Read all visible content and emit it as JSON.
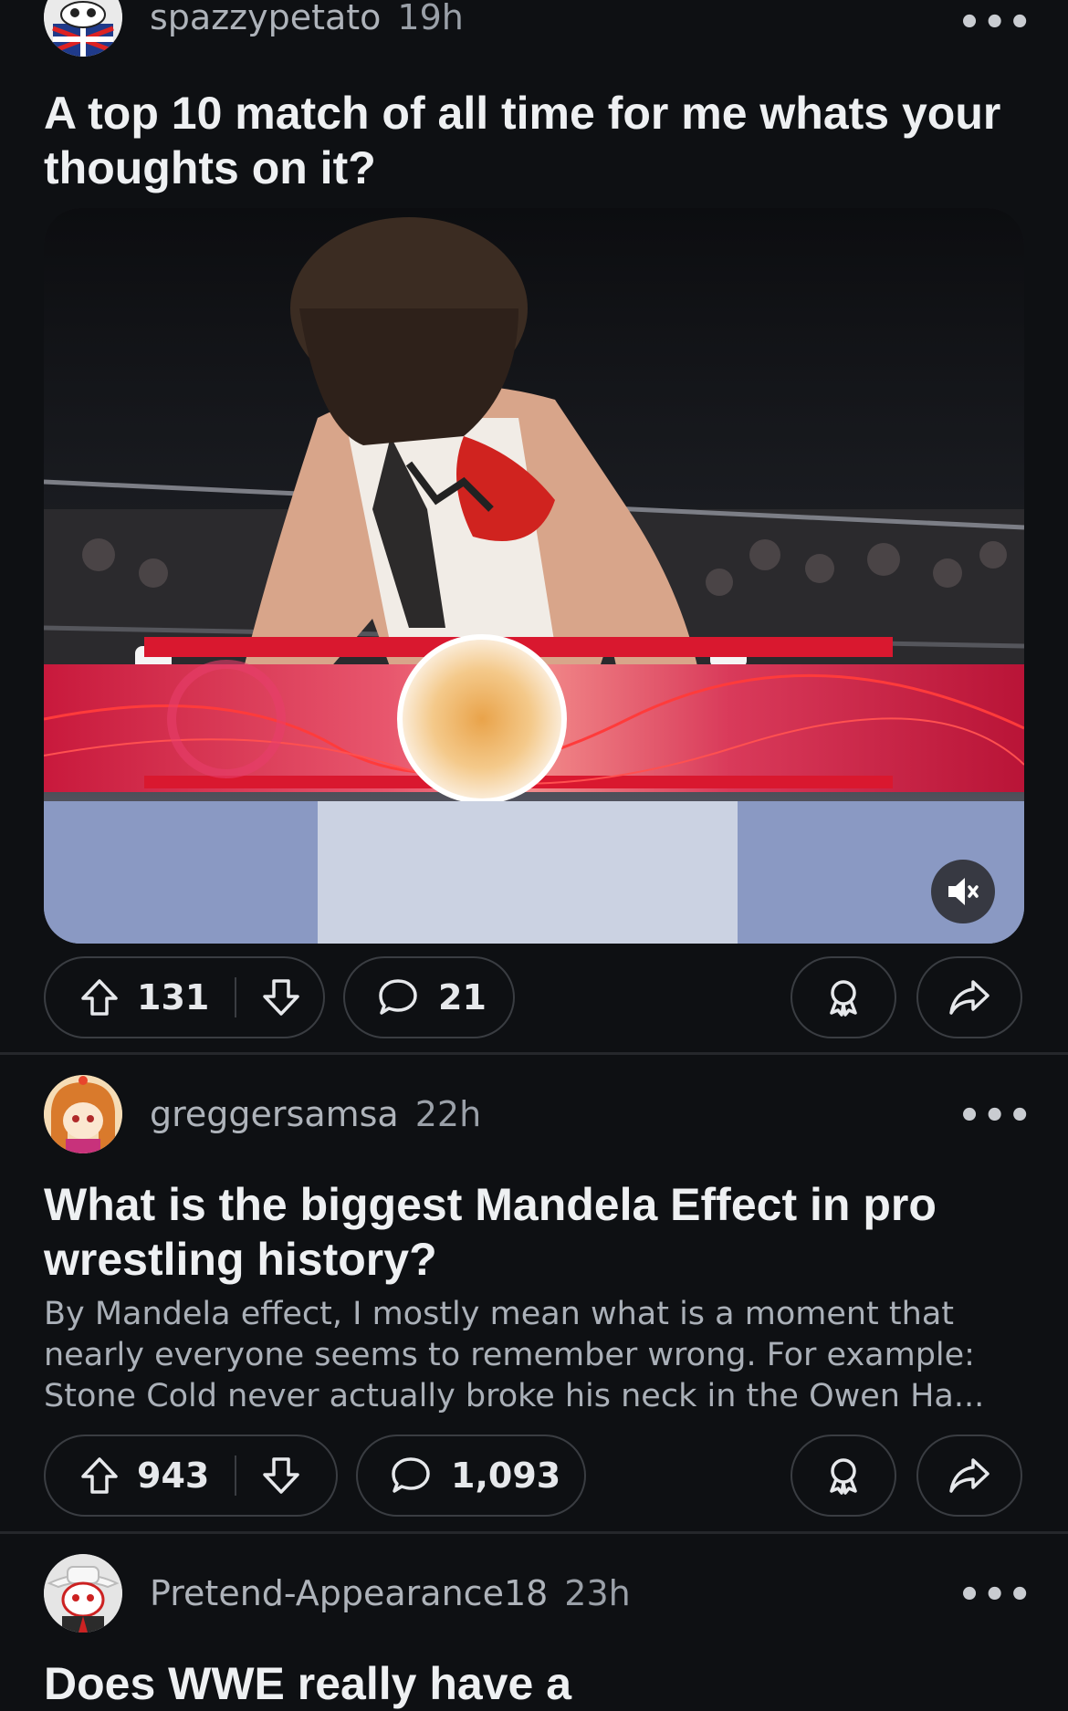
{
  "posts": [
    {
      "username": "spazzypetato",
      "time": "19h",
      "title": "A top 10 match of all time for me whats your thoughts on it?",
      "upvotes": "131",
      "comments": "21"
    },
    {
      "username": "greggersamsa",
      "time": "22h",
      "title": "What is the biggest Mandela Effect in pro wrestling history?",
      "body": "By Mandela effect, I mostly mean what is a moment that nearly everyone seems to remember wrong. For example: Stone Cold never actually broke his neck in the Owen Ha...",
      "upvotes": "943",
      "comments": "1,093"
    },
    {
      "username": "Pretend-Appearance18",
      "time": "23h",
      "title": "Does WWE really have a"
    }
  ],
  "more_label": "•••",
  "colors": {
    "background": "#0e1013",
    "border": "#3a3d42",
    "text_primary": "#eef0f2",
    "text_secondary": "#9aa0a8"
  },
  "icons": [
    "upvote-icon",
    "downvote-icon",
    "comment-icon",
    "award-icon",
    "share-icon",
    "mute-icon",
    "more-icon"
  ]
}
